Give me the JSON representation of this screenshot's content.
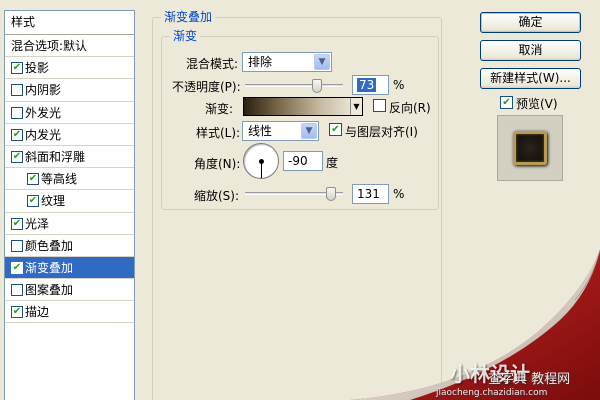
{
  "style_list": {
    "header": "样式",
    "blend_options": "混合选项:默认",
    "items": [
      {
        "label": "投影",
        "checked": true,
        "sub": false,
        "selected": false
      },
      {
        "label": "内阴影",
        "checked": false,
        "sub": false,
        "selected": false
      },
      {
        "label": "外发光",
        "checked": false,
        "sub": false,
        "selected": false
      },
      {
        "label": "内发光",
        "checked": true,
        "sub": false,
        "selected": false
      },
      {
        "label": "斜面和浮雕",
        "checked": true,
        "sub": false,
        "selected": false
      },
      {
        "label": "等高线",
        "checked": true,
        "sub": true,
        "selected": false
      },
      {
        "label": "纹理",
        "checked": true,
        "sub": true,
        "selected": false
      },
      {
        "label": "光泽",
        "checked": true,
        "sub": false,
        "selected": false
      },
      {
        "label": "颜色叠加",
        "checked": false,
        "sub": false,
        "selected": false
      },
      {
        "label": "渐变叠加",
        "checked": true,
        "sub": false,
        "selected": true
      },
      {
        "label": "图案叠加",
        "checked": false,
        "sub": false,
        "selected": false
      },
      {
        "label": "描边",
        "checked": true,
        "sub": false,
        "selected": false
      }
    ]
  },
  "panel": {
    "outer_title": "渐变叠加",
    "inner_title": "渐变",
    "blend_mode_label": "混合模式:",
    "blend_mode_value": "排除",
    "opacity_label": "不透明度(P):",
    "opacity_value": "73",
    "opacity_unit": "%",
    "opacity_level": 73,
    "gradient_label": "渐变:",
    "reverse_label": "反向(R)",
    "reverse_checked": false,
    "style_label": "样式(L):",
    "style_value": "线性",
    "align_label": "与图层对齐(I)",
    "align_checked": true,
    "angle_label": "角度(N):",
    "angle_value": "-90",
    "angle_unit": "度",
    "scale_label": "缩放(S):",
    "scale_value": "131",
    "scale_unit": "%",
    "scale_level": 131
  },
  "buttons": {
    "ok": "确定",
    "cancel": "取消",
    "new_style": "新建样式(W)...",
    "preview_label": "预览(V)",
    "preview_checked": true
  },
  "watermark": {
    "brand": "小林设计",
    "site": "查字典 教程网",
    "url": "jiaocheng.chazidian.com"
  },
  "colors": {
    "selection": "#316ac5",
    "group_title": "#0046d5",
    "curl_red": "#b21a1a"
  }
}
